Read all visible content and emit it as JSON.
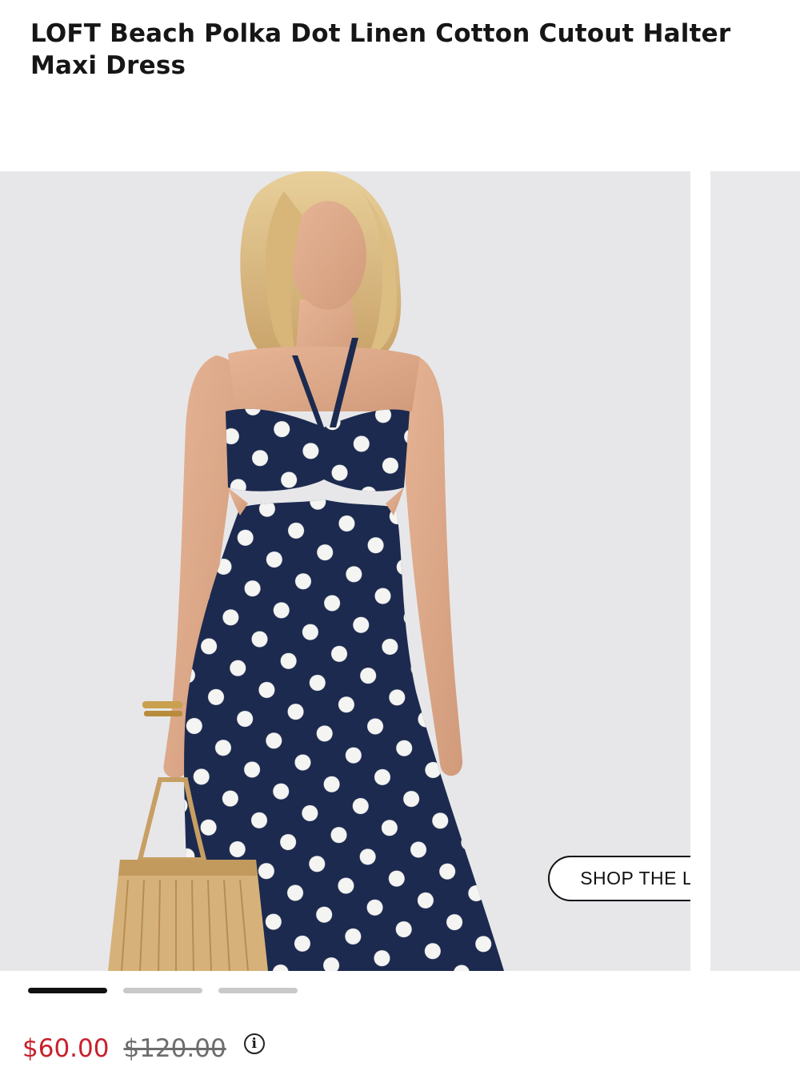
{
  "product": {
    "title": "LOFT Beach Polka Dot Linen Cotton Cutout Halter Maxi Dress"
  },
  "gallery": {
    "main_image": "model-in-navy-polka-dot-halter-maxi-dress",
    "shop_the_look_label": "SHOP THE LOOK",
    "slide_count": 3,
    "active_slide": 0
  },
  "pricing": {
    "sale_price": "$60.00",
    "original_price": "$120.00",
    "info_icon": "info-icon"
  },
  "colors": {
    "sale_price": "#c8202b",
    "dress_navy": "#1c2a4f",
    "background": "#e7e7ea"
  }
}
